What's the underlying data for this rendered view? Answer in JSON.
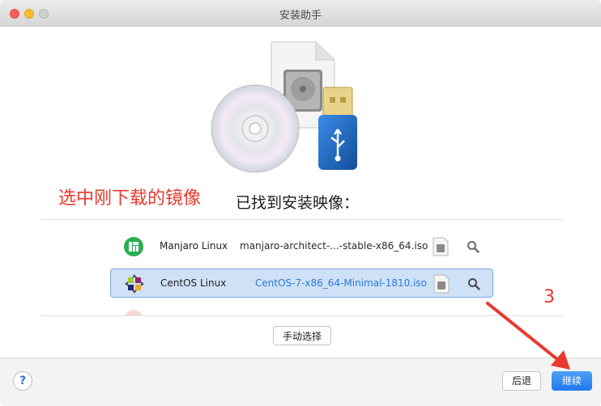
{
  "window": {
    "title": "安装助手"
  },
  "annotation": {
    "text": "选中刚下载的镜像",
    "step_number": "3"
  },
  "heading": "已找到安装映像：",
  "images": [
    {
      "os": "Manjaro Linux",
      "iso": "manjaro-architect-...-stable-x86_64.iso",
      "selected": false,
      "icon": "manjaro-logo"
    },
    {
      "os": "CentOS Linux",
      "iso": "CentOS-7-x86_64-Minimal-1810.iso",
      "selected": true,
      "icon": "centos-logo"
    }
  ],
  "buttons": {
    "manual_select": "手动选择",
    "help": "?",
    "back": "后退",
    "continue": "继续"
  },
  "colors": {
    "accent": "#1f78ee",
    "annotation": "#e8392d",
    "selection": "#cfe1f7"
  }
}
